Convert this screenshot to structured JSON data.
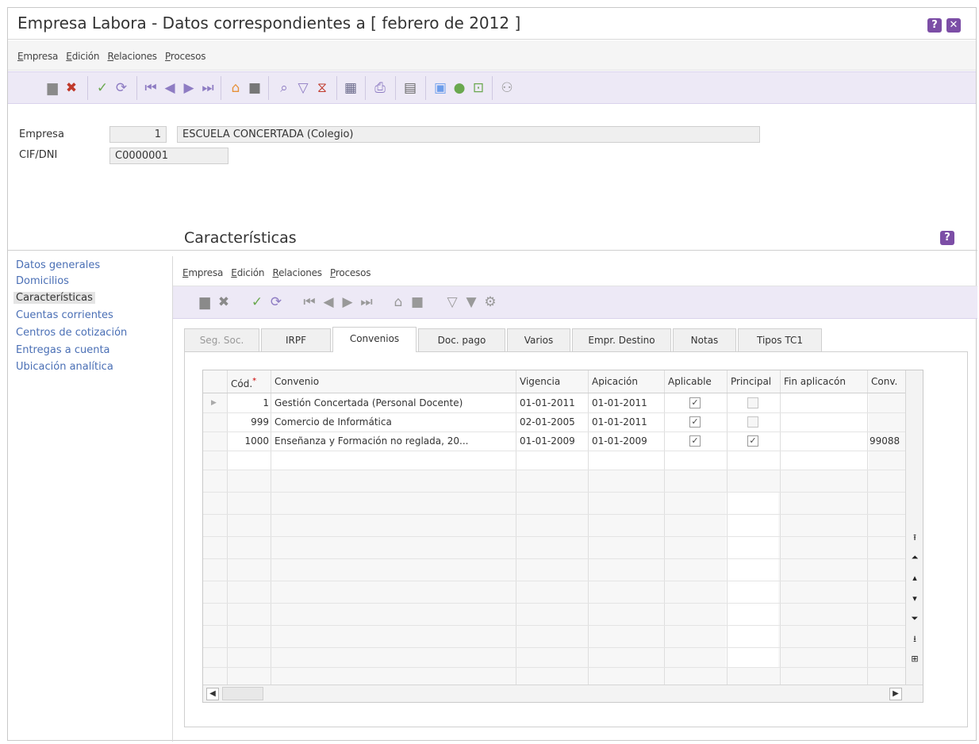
{
  "window": {
    "title": "Empresa Labora - Datos correspondientes a [ febrero de 2012 ]",
    "help_label": "?",
    "close_label": "✕"
  },
  "menu": [
    {
      "u": "E",
      "rest": "mpresa"
    },
    {
      "u": "E",
      "rest": "dición"
    },
    {
      "u": "R",
      "rest": "elaciones"
    },
    {
      "u": "P",
      "rest": "rocesos"
    }
  ],
  "toolbar_icons": {
    "new": "new-document-icon",
    "delete": "delete-icon",
    "accept": "check-icon",
    "refresh": "refresh-icon",
    "first": "first-record-icon",
    "prev": "previous-record-icon",
    "next": "next-record-icon",
    "last": "last-record-icon",
    "home": "home-icon",
    "stop": "stop-icon",
    "search": "search-icon",
    "filter": "filter-icon",
    "clear_filter": "clear-filter-icon",
    "calculator": "calculator-icon",
    "print": "print-icon",
    "report": "report-icon",
    "contacts": "contacts-icon",
    "user": "user-icon",
    "export": "export-icon",
    "users": "users-icon"
  },
  "header": {
    "empresa_label": "Empresa",
    "empresa_code": "1",
    "empresa_name": "ESCUELA CONCERTADA (Colegio)",
    "cif_label": "CIF/DNI",
    "cif_value": "C0000001"
  },
  "nav": {
    "items": [
      "Datos generales",
      "Domicilios",
      "Características",
      "Cuentas corrientes",
      "Centros de cotización",
      "Entregas a cuenta",
      "Ubicación analítica"
    ],
    "active_index": 2
  },
  "section": {
    "title": "Características",
    "help_label": "?",
    "menu": [
      {
        "u": "E",
        "rest": "mpresa"
      },
      {
        "u": "E",
        "rest": "dición"
      },
      {
        "u": "R",
        "rest": "elaciones"
      },
      {
        "u": "P",
        "rest": "rocesos"
      }
    ]
  },
  "tabs": [
    {
      "label": "Seg. Soc.",
      "state": "disabled"
    },
    {
      "label": "IRPF",
      "state": "normal"
    },
    {
      "label": "Convenios",
      "state": "active"
    },
    {
      "label": "Doc. pago",
      "state": "normal"
    },
    {
      "label": "Varios",
      "state": "normal"
    },
    {
      "label": "Empr. Destino",
      "state": "normal"
    },
    {
      "label": "Notas",
      "state": "normal"
    },
    {
      "label": "Tipos TC1",
      "state": "normal"
    }
  ],
  "grid": {
    "columns": [
      "Cód.",
      "Convenio",
      "Vigencia",
      "Apicación",
      "Aplicable",
      "Principal",
      "Fin aplicacón",
      "Conv."
    ],
    "required_mark": "*",
    "rows": [
      {
        "cod": "1",
        "convenio": "Gestión Concertada (Personal Docente)",
        "vigencia": "01-01-2011",
        "aplicacion": "01-01-2011",
        "aplicable": true,
        "principal": false,
        "fin": "",
        "conv": ""
      },
      {
        "cod": "999",
        "convenio": "Comercio de Informática",
        "vigencia": "02-01-2005",
        "aplicacion": "01-01-2011",
        "aplicable": true,
        "principal": false,
        "fin": "",
        "conv": ""
      },
      {
        "cod": "1000",
        "convenio": "Enseñanza y Formación no reglada, 20...",
        "vigencia": "01-01-2009",
        "aplicacion": "01-01-2009",
        "aplicable": true,
        "principal": true,
        "fin": "",
        "conv": "99088"
      }
    ],
    "scroll": {
      "first": "⭱",
      "page_up": "⏶",
      "up": "▴",
      "down": "▾",
      "page_down": "⏷",
      "last": "⭳",
      "expand": "⊞",
      "left": "◀",
      "right": "▶"
    }
  }
}
